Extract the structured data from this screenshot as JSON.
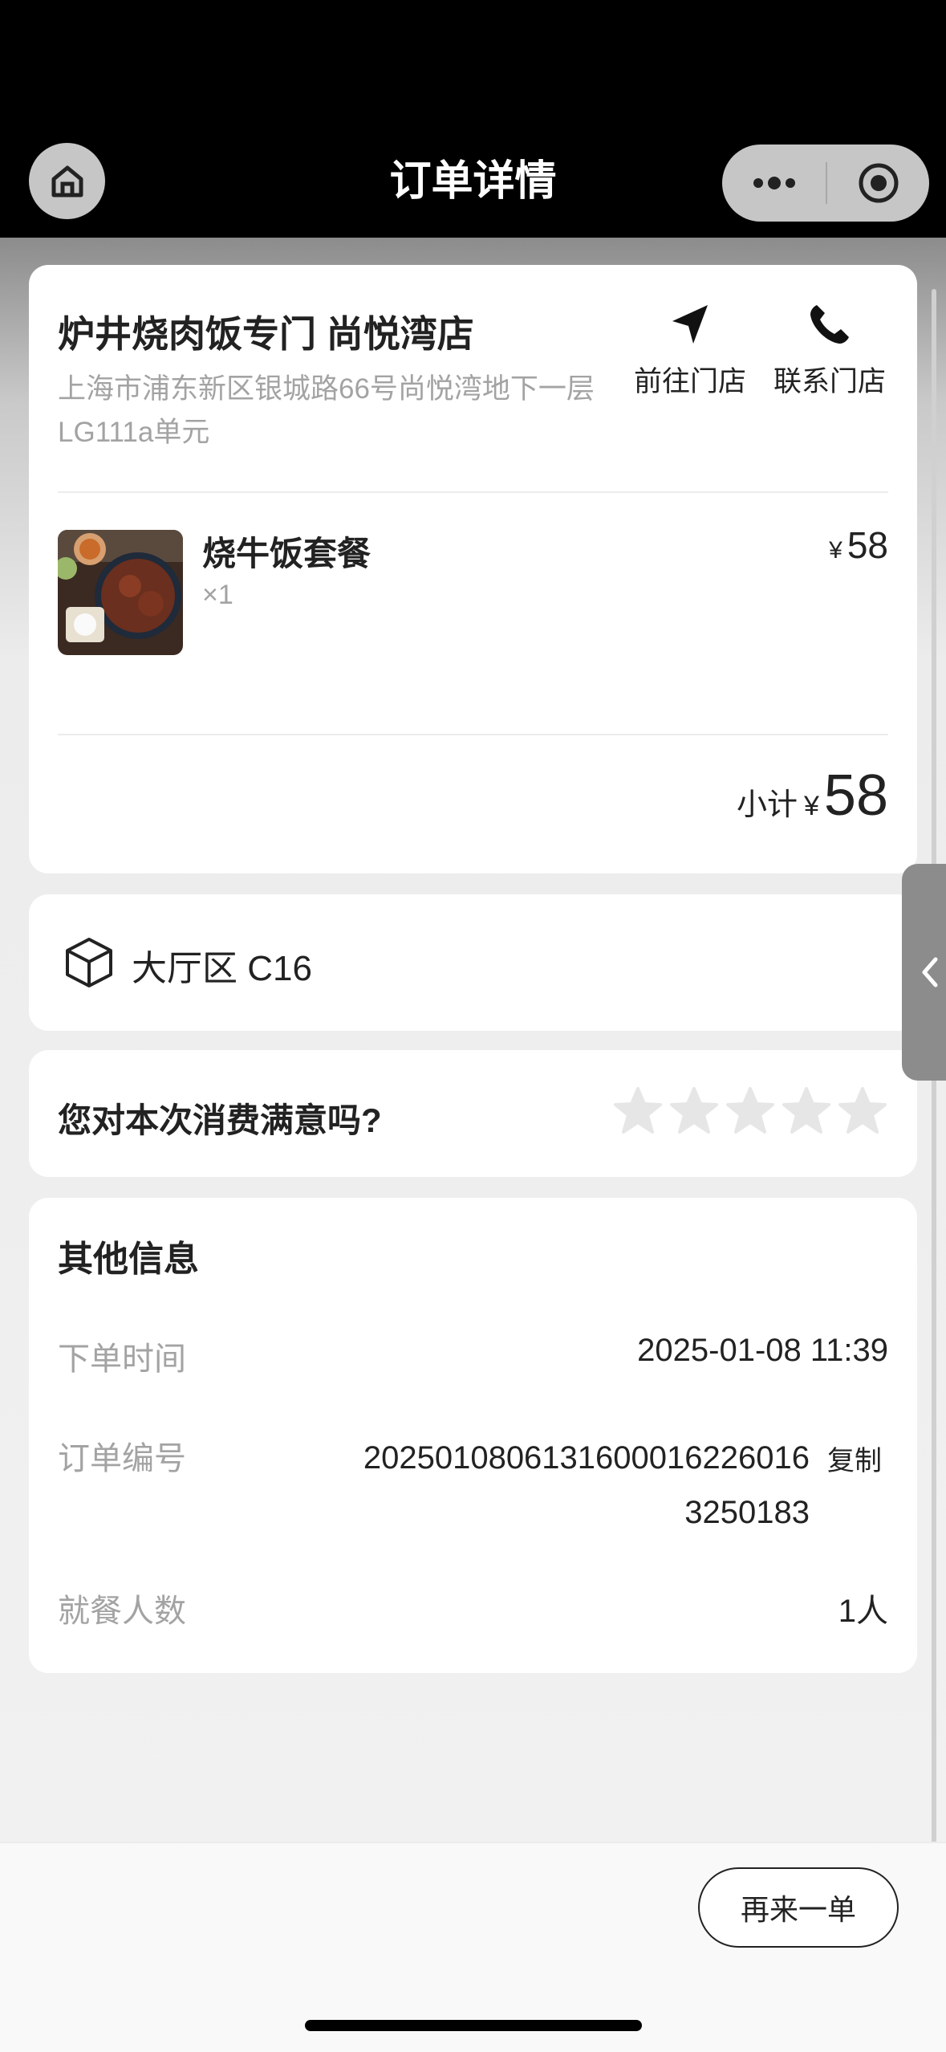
{
  "nav": {
    "title": "订单详情",
    "home_icon": "home-icon",
    "more_icon": "more-dots-icon",
    "close_icon": "target-circle-icon"
  },
  "store": {
    "name": "炉井烧肉饭专门 尚悦湾店",
    "address": "上海市浦东新区银城路66号尚悦湾地下一层LG111a单元",
    "navigate_label": "前往门店",
    "call_label": "联系门店"
  },
  "items": [
    {
      "name": "烧牛饭套餐",
      "qty": "×1",
      "currency": "¥",
      "price": "58"
    }
  ],
  "subtotal": {
    "label": "小计",
    "currency": "¥",
    "amount": "58"
  },
  "table": {
    "label": "大厅区 C16"
  },
  "rating": {
    "question": "您对本次消费满意吗?",
    "stars_filled": 0,
    "stars_total": 5
  },
  "other_info": {
    "title": "其他信息",
    "order_time_label": "下单时间",
    "order_time": "2025-01-08 11:39",
    "order_no_label": "订单编号",
    "order_no": "20250108061316000162260163250183",
    "copy_label": "复制",
    "diners_label": "就餐人数",
    "diners": "1人"
  },
  "footer": {
    "reorder_label": "再来一单"
  },
  "colors": {
    "text": "#222222",
    "muted": "#a3a3a3",
    "topbar": "#000000",
    "star_empty": "#e6e6e6"
  }
}
